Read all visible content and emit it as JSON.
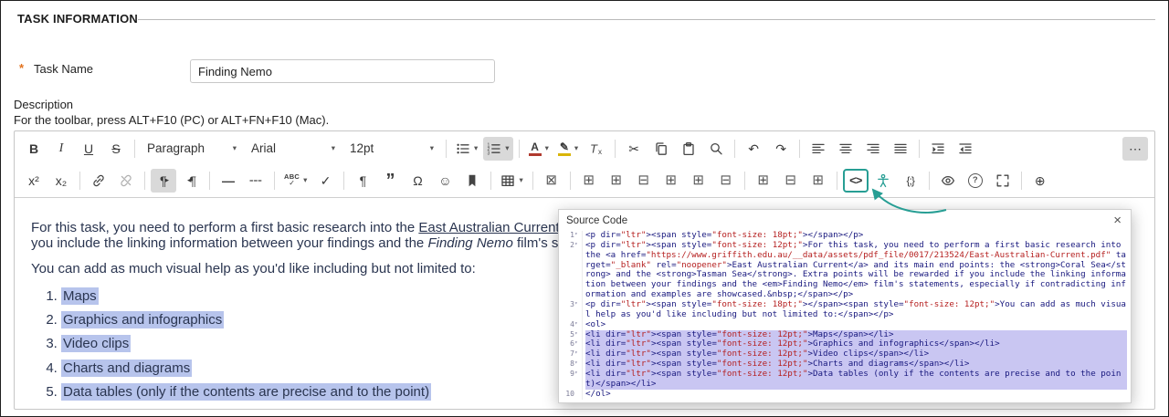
{
  "header": {
    "title": "TASK INFORMATION"
  },
  "task_name": {
    "required_marker": "*",
    "label": "Task Name",
    "value": "Finding Nemo"
  },
  "description": {
    "label": "Description",
    "toolbar_hint": "For the toolbar, press ALT+F10 (PC) or ALT+FN+F10 (Mac)."
  },
  "colors": {
    "accent_teal": "#279e94",
    "text_selection": "#b7c4ec",
    "code_selection": "#c9c6f2",
    "required_marker": "#e2731f"
  },
  "toolbar": {
    "row1": [
      {
        "name": "bold",
        "glyph": "B",
        "cls": "b"
      },
      {
        "name": "italic",
        "glyph": "I",
        "cls": "i"
      },
      {
        "name": "underline",
        "glyph": "U",
        "cls": "u"
      },
      {
        "name": "strikethrough",
        "glyph": "S",
        "cls": "s",
        "sep": true
      },
      {
        "name": "block-format",
        "label": "Paragraph",
        "type": "select",
        "dropdown": true
      },
      {
        "name": "font-family",
        "label": "Arial",
        "type": "select",
        "dropdown": true
      },
      {
        "name": "font-size",
        "label": "12pt",
        "type": "select",
        "dropdown": true,
        "sep": true
      },
      {
        "name": "bullet-list",
        "icon": "ul",
        "dropdown": true
      },
      {
        "name": "numbered-list",
        "icon": "ol",
        "dropdown": true,
        "active": true,
        "sep": true
      },
      {
        "name": "text-color",
        "icon": "textcolor",
        "dropdown": true
      },
      {
        "name": "highlight-color",
        "icon": "highlight",
        "dropdown": true
      },
      {
        "name": "clear-formatting",
        "icon": "clearfmt",
        "sep": true
      },
      {
        "name": "cut",
        "glyph": "✂"
      },
      {
        "name": "copy",
        "icon": "copy"
      },
      {
        "name": "paste",
        "icon": "paste"
      },
      {
        "name": "find-replace",
        "icon": "search",
        "sep": true
      },
      {
        "name": "undo",
        "glyph": "↶"
      },
      {
        "name": "redo",
        "glyph": "↷",
        "sep": true
      },
      {
        "name": "align-left",
        "icon": "alignleft"
      },
      {
        "name": "align-center",
        "icon": "aligncenter"
      },
      {
        "name": "align-right",
        "icon": "alignright"
      },
      {
        "name": "justify",
        "icon": "justify",
        "sep": true
      },
      {
        "name": "indent",
        "icon": "indent"
      },
      {
        "name": "outdent",
        "icon": "outdent"
      },
      {
        "name": "more-toolbar",
        "glyph": "⋯",
        "active": true,
        "push_right": true
      }
    ],
    "row2": [
      {
        "name": "superscript",
        "glyph": "x²"
      },
      {
        "name": "subscript",
        "glyph": "x₂",
        "sep": true
      },
      {
        "name": "insert-link",
        "icon": "link"
      },
      {
        "name": "remove-link",
        "icon": "unlink",
        "disabled": true,
        "sep": true
      },
      {
        "name": "ltr-paragraph",
        "icon": "ltr",
        "active": true
      },
      {
        "name": "rtl-paragraph",
        "icon": "rtl",
        "sep": true
      },
      {
        "name": "horizontal-rule",
        "glyph": "—",
        "cls": "dash"
      },
      {
        "name": "page-break",
        "icon": "pagebreak",
        "sep": true
      },
      {
        "name": "spellcheck",
        "icon": "spellcheck",
        "dropdown": true
      },
      {
        "name": "spellcheck-toggle",
        "glyph": "✓",
        "sep": true
      },
      {
        "name": "show-invisible-characters",
        "glyph": "¶"
      },
      {
        "name": "blockquote",
        "glyph": "”",
        "cls": "quote"
      },
      {
        "name": "special-character",
        "glyph": "Ω"
      },
      {
        "name": "emoticons",
        "glyph": "☺"
      },
      {
        "name": "anchor",
        "icon": "bookmark",
        "sep": true
      },
      {
        "name": "table",
        "icon": "table",
        "dropdown": true,
        "sep": true
      },
      {
        "name": "delete-table",
        "glyph": "⊠",
        "cls": "grid",
        "sep": true
      },
      {
        "name": "insert-row-above",
        "glyph": "⊞",
        "cls": "grid"
      },
      {
        "name": "insert-row-below",
        "glyph": "⊞",
        "cls": "grid"
      },
      {
        "name": "delete-row",
        "glyph": "⊟",
        "cls": "grid"
      },
      {
        "name": "insert-column-before",
        "glyph": "⊞",
        "cls": "grid"
      },
      {
        "name": "insert-column-after",
        "glyph": "⊞",
        "cls": "grid"
      },
      {
        "name": "delete-column",
        "glyph": "⊟",
        "cls": "grid",
        "sep": true
      },
      {
        "name": "merge-cells",
        "glyph": "⊞",
        "cls": "grid"
      },
      {
        "name": "split-cell",
        "glyph": "⊟",
        "cls": "grid"
      },
      {
        "name": "cell-properties",
        "glyph": "⊞",
        "cls": "grid",
        "sep": true
      },
      {
        "name": "source-code",
        "glyph": "<>",
        "cls": "srccode",
        "teal": true
      },
      {
        "name": "accessibility-checker",
        "icon": "person"
      },
      {
        "name": "code-sample",
        "glyph": "{;}",
        "cls": "codesample",
        "sep": true
      },
      {
        "name": "preview",
        "icon": "eye"
      },
      {
        "name": "help",
        "icon": "help"
      },
      {
        "name": "fullscreen",
        "icon": "fullscreen",
        "sep": true
      },
      {
        "name": "insert",
        "glyph": "⊕"
      }
    ]
  },
  "editor": {
    "paragraph1_parts": [
      {
        "text": "For this task, you need to perform a first basic research into the "
      },
      {
        "text": "East Australian Current",
        "style": "link"
      },
      {
        "text": " and its main end points: the "
      },
      {
        "text": "Coral Sea",
        "style": "bold"
      },
      {
        "text": " and the "
      },
      {
        "text": "Tasman Sea",
        "style": "bold"
      },
      {
        "text": ". Extra points will be rewarded if you include the linking information between your findings and the "
      },
      {
        "text": "Finding Nemo",
        "style": "italic"
      },
      {
        "text": " film's statements, especially if contradicting information and examples are showcased."
      }
    ],
    "paragraph2": "You can add as much visual help as you'd like including but not limited to:",
    "list_items": [
      "Maps",
      "Graphics and infographics",
      "Video clips",
      "Charts and diagrams",
      "Data tables (only if the contents are precise and to the point)"
    ]
  },
  "source_code_dialog": {
    "title": "Source Code",
    "close_label": "×",
    "lines": [
      {
        "n": 1,
        "fold": true,
        "selected": false,
        "text": "<p dir=\"ltr\"><span style=\"font-size: 18pt;\"></span></p>"
      },
      {
        "n": 2,
        "fold": true,
        "selected": false,
        "text": "<p dir=\"ltr\"><span style=\"font-size: 12pt;\">For this task, you need to perform a first basic research into the <a href=\"https://www.griffith.edu.au/__data/assets/pdf_file/0017/213524/East-Australian-Current.pdf\" target=\"_blank\" rel=\"noopener\">East Australian Current</a> and its main end points: the <strong>Coral Sea</strong> and the <strong>Tasman Sea</strong>. Extra points will be rewarded if you include the linking information between your findings and the <em>Finding Nemo</em> film's statements, especially if contradicting information and examples are showcased.&nbsp;</span></p>"
      },
      {
        "n": 3,
        "fold": true,
        "selected": false,
        "text": "<p dir=\"ltr\"><span style=\"font-size: 18pt;\"></span><span style=\"font-size: 12pt;\">You can add as much visual help as you'd like including but not limited to:</span></p>"
      },
      {
        "n": 4,
        "fold": true,
        "selected": false,
        "text": "<ol>"
      },
      {
        "n": 5,
        "fold": true,
        "selected": true,
        "text": "<li dir=\"ltr\"><span style=\"font-size: 12pt;\">Maps</span></li>"
      },
      {
        "n": 6,
        "fold": true,
        "selected": true,
        "text": "<li dir=\"ltr\"><span style=\"font-size: 12pt;\">Graphics and infographics</span></li>"
      },
      {
        "n": 7,
        "fold": true,
        "selected": true,
        "text": "<li dir=\"ltr\"><span style=\"font-size: 12pt;\">Video clips</span></li>"
      },
      {
        "n": 8,
        "fold": true,
        "selected": true,
        "text": "<li dir=\"ltr\"><span style=\"font-size: 12pt;\">Charts and diagrams</span></li>"
      },
      {
        "n": 9,
        "fold": true,
        "selected": true,
        "text": "<li dir=\"ltr\"><span style=\"font-size: 12pt;\">Data tables (only if the contents are precise and to the point)</span></li>"
      },
      {
        "n": 10,
        "fold": false,
        "selected": false,
        "text": "</ol>"
      }
    ]
  }
}
